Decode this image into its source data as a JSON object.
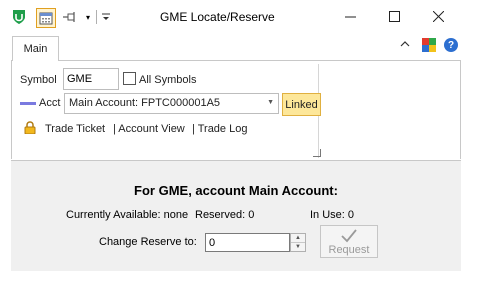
{
  "window": {
    "title": "GME Locate/Reserve",
    "minimize": "—",
    "maximize": "☐",
    "close": "✕"
  },
  "toolbar": {
    "dropdown_glyph": "▾",
    "customize_glyph": "⩡"
  },
  "ribbon": {
    "tab_main": "Main",
    "collapse_glyph": "⌃",
    "help_glyph": "?"
  },
  "symbol": {
    "label": "Symbol",
    "value": "GME",
    "all_symbols_label": "All Symbols",
    "all_symbols_checked": false
  },
  "account": {
    "label": "Acct",
    "value": "Main Account: FPTC000001A5",
    "linked_label": "Linked",
    "arrow": "▼"
  },
  "links": {
    "trade_ticket": "Trade Ticket",
    "account_view": "| Account View",
    "trade_log": "| Trade Log"
  },
  "reserve": {
    "heading": "For GME, account Main Account:",
    "currently_available": "Currently Available:  none",
    "reserved": "Reserved:  0",
    "in_use": "In Use:  0",
    "change_label": "Change Reserve to:",
    "change_value": "0",
    "spin_up": "▲",
    "spin_down": "▼",
    "request_label": "Request"
  },
  "colors": {
    "linked_bg": "#fde79a",
    "acct_marker": "#7a7ae0",
    "help_blue": "#2d6fd0",
    "app_green": "#1e9e4a"
  }
}
